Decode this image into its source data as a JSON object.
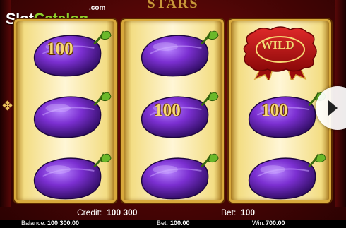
{
  "logo": {
    "slot": "Slot",
    "catalog": "Catalog",
    "com": ".com"
  },
  "header": {
    "title": "STARS"
  },
  "reels": [
    [
      {
        "symbol": "plum-100",
        "value": "100"
      },
      {
        "symbol": "plum"
      },
      {
        "symbol": "plum"
      }
    ],
    [
      {
        "symbol": "plum"
      },
      {
        "symbol": "plum-100",
        "value": "100"
      },
      {
        "symbol": "plum"
      }
    ],
    [
      {
        "symbol": "wild",
        "label": "WILD"
      },
      {
        "symbol": "plum-100",
        "value": "100"
      },
      {
        "symbol": "plum"
      }
    ]
  ],
  "info": {
    "credit_label": "Credit:",
    "credit_value": "100 300",
    "bet_label": "Bet:",
    "bet_value": "100"
  },
  "status": {
    "balance_label": "Balance:",
    "balance_value": "100 300.00",
    "bet_label": "Bet:",
    "bet_value": "100.00",
    "win_label": "Win:",
    "win_value": "700.00"
  },
  "icons": {
    "next": "chevron-right-icon",
    "ornament": "fleur-ornament-icon"
  },
  "colors": {
    "plum": "#7b2fd1",
    "gold": "#f6d874",
    "logo_green": "#8fcf2a",
    "wild_red": "#b31212"
  }
}
